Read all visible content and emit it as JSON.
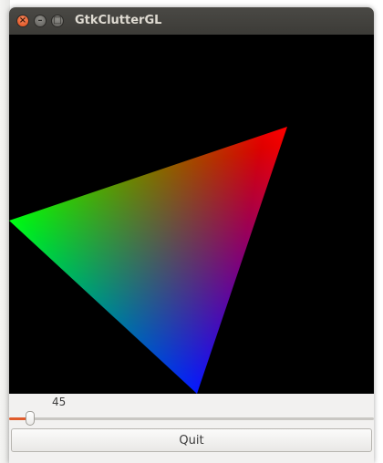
{
  "window": {
    "title": "GtkClutterGL",
    "controls": [
      "close-icon",
      "minimize-icon",
      "maximize-icon"
    ]
  },
  "stage": {
    "background": "#000000",
    "triangle": {
      "vertex_colors": [
        "#ff0000",
        "#00ff00",
        "#0000ff"
      ]
    }
  },
  "slider": {
    "value_label": "45",
    "value": 45,
    "min": 0,
    "max": 360,
    "accent": "#e05c2c"
  },
  "quit_label": "Quit"
}
